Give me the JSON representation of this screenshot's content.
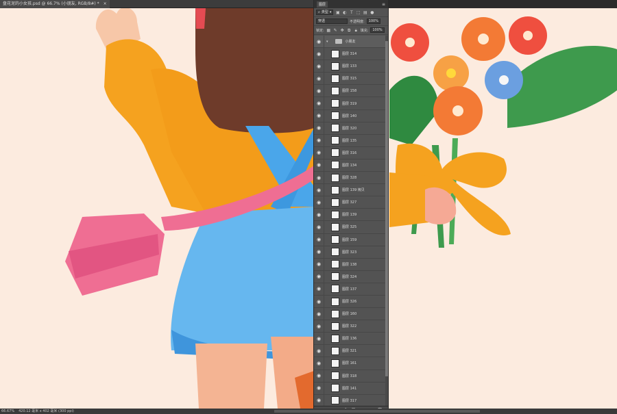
{
  "document": {
    "tab_title": "盘花泥的小女孩.psd @ 66.7% (小朋友, RGB/8#) *",
    "close_glyph": "×"
  },
  "status": {
    "zoom": "66.67%",
    "doc_size": "420.12 毫米 x 402 毫米 (300 ppi)"
  },
  "layers_panel": {
    "title": "图层",
    "menu_glyph": "≡",
    "filter_kind": "类型",
    "blend_mode": "穿透",
    "opacity_label": "不透明度:",
    "opacity_value": "100%",
    "lock_label": "锁定:",
    "fill_label": "填充:",
    "fill_value": "100%",
    "group_name": "小朋友",
    "layers": [
      {
        "name": "图层 314"
      },
      {
        "name": "图层 133"
      },
      {
        "name": "图层 315"
      },
      {
        "name": "图层 158"
      },
      {
        "name": "图层 319"
      },
      {
        "name": "图层 140"
      },
      {
        "name": "图层 320"
      },
      {
        "name": "图层 135"
      },
      {
        "name": "图层 316"
      },
      {
        "name": "图层 134"
      },
      {
        "name": "图层 328"
      },
      {
        "name": "图层 139 拷贝"
      },
      {
        "name": "图层 327"
      },
      {
        "name": "图层 139"
      },
      {
        "name": "图层 325"
      },
      {
        "name": "图层 159"
      },
      {
        "name": "图层 323"
      },
      {
        "name": "图层 138"
      },
      {
        "name": "图层 324"
      },
      {
        "name": "图层 137"
      },
      {
        "name": "图层 326"
      },
      {
        "name": "图层 160"
      },
      {
        "name": "图层 322"
      },
      {
        "name": "图层 136"
      },
      {
        "name": "图层 321"
      },
      {
        "name": "图层 161"
      },
      {
        "name": "图层 318"
      },
      {
        "name": "图层 141"
      },
      {
        "name": "图层 317"
      }
    ]
  },
  "colors": {
    "canvas_bg": "#fcebdf",
    "panel_bg": "#535353",
    "sleeve_orange": "#f5a21f",
    "skirt_blue": "#66b7ef",
    "bag_pink": "#ef6e93",
    "hair_brown": "#6e3b2a",
    "flower_orange": "#f37a35",
    "leaf_green": "#3e9a4d"
  }
}
